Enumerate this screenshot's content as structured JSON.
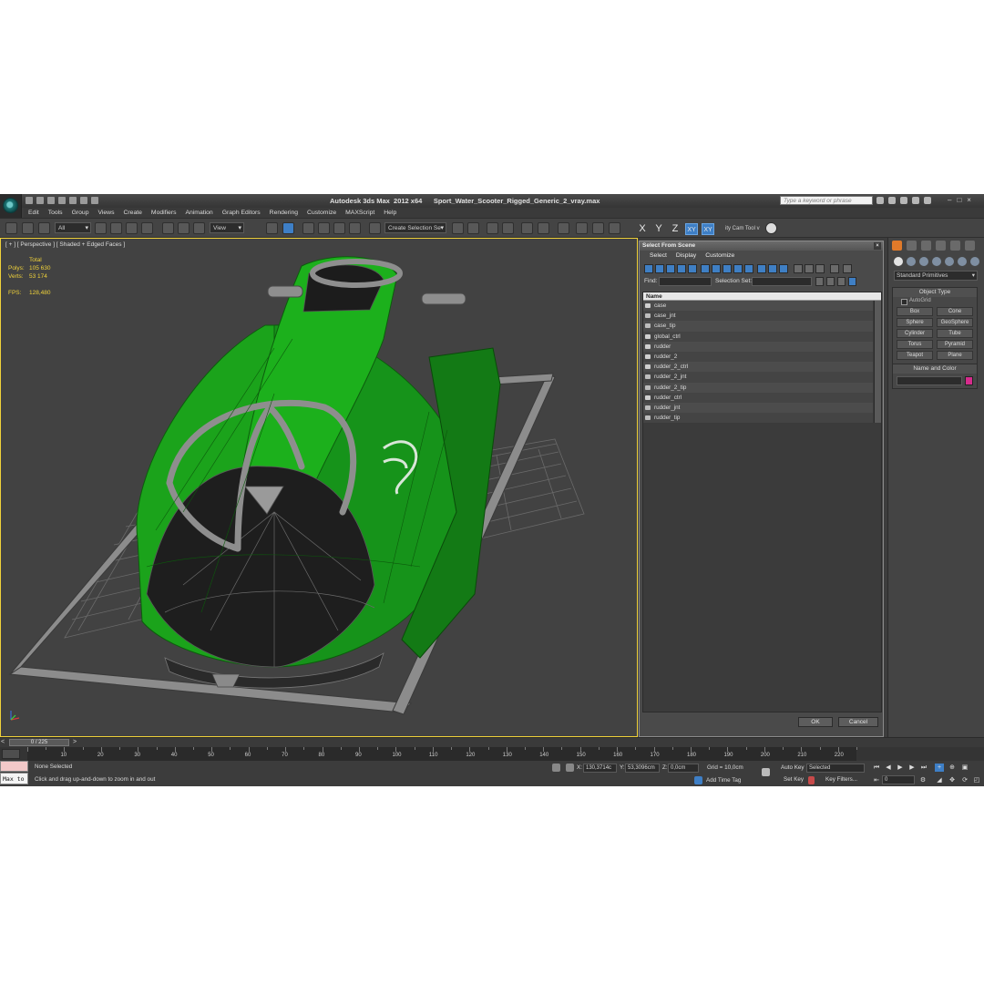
{
  "title": {
    "app": "Autodesk 3ds Max  2012 x64",
    "file": "Sport_Water_Scooter_Rigged_Generic_2_vray.max",
    "search_placeholder": "Type a keyword or phrase"
  },
  "menu": [
    "Edit",
    "Tools",
    "Group",
    "Views",
    "Create",
    "Modifiers",
    "Animation",
    "Graph Editors",
    "Rendering",
    "Customize",
    "MAXScript",
    "Help"
  ],
  "toolbar": {
    "filter": "All",
    "ref_coord": "View",
    "selection_set": "Create Selection Se",
    "axes": [
      "X",
      "Y",
      "Z",
      "XY",
      "XY"
    ],
    "camera_tool": "ity Cam Tool v"
  },
  "viewport": {
    "label": "[ + ] [ Perspective ] [ Shaded + Edged Faces ]",
    "stats": {
      "total_label": "Total",
      "polys_label": "Polys:",
      "polys": "105 630",
      "verts_label": "Verts:",
      "verts": "53 174",
      "fps_label": "FPS:",
      "fps": "128,480"
    },
    "colors": {
      "hull": "#1aa81a",
      "dark": "#1f1f1f",
      "wire": "#6b6b6b",
      "base": "#8a8a8a"
    }
  },
  "dialog": {
    "title": "Select From Scene",
    "menu": [
      "Select",
      "Display",
      "Customize"
    ],
    "find_label": "Find:",
    "selection_set_label": "Selection Set:",
    "column": "Name",
    "items": [
      {
        "name": "case",
        "icon": "object-icon"
      },
      {
        "name": "case_jnt",
        "icon": "helper-icon"
      },
      {
        "name": "case_tip",
        "icon": "helper-icon"
      },
      {
        "name": "global_ctrl",
        "icon": "object-icon"
      },
      {
        "name": "rudder",
        "icon": "object-icon"
      },
      {
        "name": "rudder_2",
        "icon": "object-icon"
      },
      {
        "name": "rudder_2_ctrl",
        "icon": "object-icon"
      },
      {
        "name": "rudder_2_jnt",
        "icon": "helper-icon"
      },
      {
        "name": "rudder_2_tip",
        "icon": "helper-icon"
      },
      {
        "name": "rudder_ctrl",
        "icon": "object-icon"
      },
      {
        "name": "rudder_jnt",
        "icon": "helper-icon"
      },
      {
        "name": "rudder_tip",
        "icon": "helper-icon"
      }
    ],
    "ok": "OK",
    "cancel": "Cancel"
  },
  "command_panel": {
    "category": "Standard Primitives",
    "object_type_title": "Object Type",
    "autogrid": "AutoGrid",
    "objects": [
      "Box",
      "Cone",
      "Sphere",
      "GeoSphere",
      "Cylinder",
      "Tube",
      "Torus",
      "Pyramid",
      "Teapot",
      "Plane"
    ],
    "name_color_title": "Name and Color",
    "object_color": "#d62b8c"
  },
  "timeline": {
    "frame": "0 / 225",
    "ticks": [
      "10",
      "20",
      "30",
      "40",
      "50",
      "60",
      "70",
      "80",
      "90",
      "100",
      "110",
      "120",
      "130",
      "140",
      "150",
      "160",
      "170",
      "180",
      "190",
      "200",
      "210",
      "220"
    ]
  },
  "status": {
    "maxscript": "Max to",
    "selection": "None Selected",
    "prompt": "Click and drag up-and-down to zoom in and out",
    "x_label": "X:",
    "x": "130,3714c",
    "y_label": "Y:",
    "y": "53,3096cm",
    "z_label": "Z:",
    "z": "0,0cm",
    "grid": "Grid = 10,0cm",
    "add_time_tag": "Add Time Tag",
    "auto_key": "Auto Key",
    "set_key": "Set Key",
    "key_mode": "Selected",
    "key_filters": "Key Filters...",
    "current_frame": "0"
  }
}
